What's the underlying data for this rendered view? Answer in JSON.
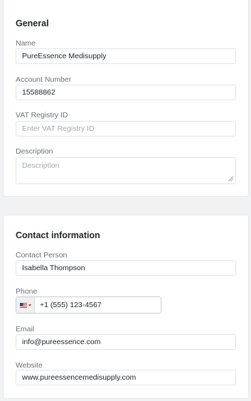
{
  "general": {
    "title": "General",
    "name_label": "Name",
    "name_value": "PureEssence Medisupply",
    "account_label": "Account Number",
    "account_value": "15588862",
    "vat_label": "VAT Registry ID",
    "vat_placeholder": "Enter VAT Registry ID",
    "description_label": "Description",
    "description_placeholder": "Description"
  },
  "contact": {
    "title": "Contact information",
    "person_label": "Contact Person",
    "person_value": "Isabella Thompson",
    "phone_label": "Phone",
    "phone_value": "+1 (555) 123-4567",
    "phone_country_icon": "us-flag-icon",
    "email_label": "Email",
    "email_value": "info@pureessence.com",
    "website_label": "Website",
    "website_value": "www.pureessencemedisupply.com"
  }
}
